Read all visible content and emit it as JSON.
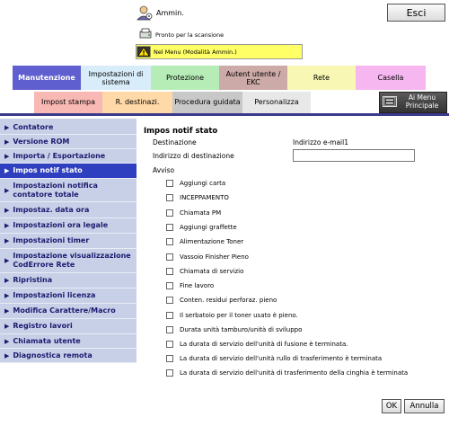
{
  "header": {
    "user_name": "Ammin.",
    "esc_label": "Esci",
    "status_text": "Pronto per la scansione",
    "warning_text": "Nel Menu (Modalità Ammin.)"
  },
  "tabs_row1": [
    {
      "label": "Manutenzione",
      "color": "#5f5fcf",
      "active": true
    },
    {
      "label": "Impostazioni di sistema",
      "color": "#d8ecfa"
    },
    {
      "label": "Protezione",
      "color": "#b6ecb6"
    },
    {
      "label": "Autent utente / EKC",
      "color": "#ccaaa8"
    },
    {
      "label": "Rete",
      "color": "#f8f8b4"
    },
    {
      "label": "Casella",
      "color": "#f6b6f0"
    }
  ],
  "tabs_row2": [
    {
      "label": "Impost stampa",
      "color": "#f8b8b4"
    },
    {
      "label": "R. destinazi.",
      "color": "#ffd9a8"
    },
    {
      "label": "Procedura guidata",
      "color": "#c8c8c8"
    },
    {
      "label": "Personalizza",
      "color": "#e8e8e8"
    }
  ],
  "menu_button_label": "Ai Menu Principale",
  "sidebar": [
    {
      "label": "Contatore"
    },
    {
      "label": "Versione ROM"
    },
    {
      "label": "Importa / Esportazione"
    },
    {
      "label": "Impos notif stato",
      "active": true
    },
    {
      "label": "Impostazioni notifica contatore totale"
    },
    {
      "label": "Impostaz. data ora"
    },
    {
      "label": "Impostazioni ora legale"
    },
    {
      "label": "Impostazioni timer"
    },
    {
      "label": "Impostazione visualizzazione CodErrore Rete"
    },
    {
      "label": "Ripristina"
    },
    {
      "label": "Impostazioni licenza"
    },
    {
      "label": "Modifica Carattere/Macro"
    },
    {
      "label": "Registro lavori"
    },
    {
      "label": "Chiamata utente"
    },
    {
      "label": "Diagnostica remota"
    }
  ],
  "main": {
    "title": "Impos notif stato",
    "destination_label": "Destinazione",
    "destination_value": "Indirizzo e-mail1",
    "address_label": "Indirizzo di destinazione",
    "address_value": "",
    "notice_label": "Avviso",
    "checkboxes": [
      "Aggiungi carta",
      "INCEPPAMENTO",
      "Chiamata PM",
      "Aggiungi graffette",
      "Alimentazione Toner",
      "Vassoio Finisher Pieno",
      "Chiamata di servizio",
      "Fine lavoro",
      "Conten. residui perforaz. pieno",
      "Il serbatoio per il toner usato è pieno.",
      "Durata unità tamburo/unità di sviluppo",
      "La durata di servizio dell'unità di fusione è terminata.",
      "La durata di servizio dell'unità rullo di trasferimento è terminata",
      "La durata di servizio dell'unità di trasferimento della cinghia è terminata"
    ]
  },
  "footer": {
    "ok_label": "OK",
    "cancel_label": "Annulla"
  }
}
